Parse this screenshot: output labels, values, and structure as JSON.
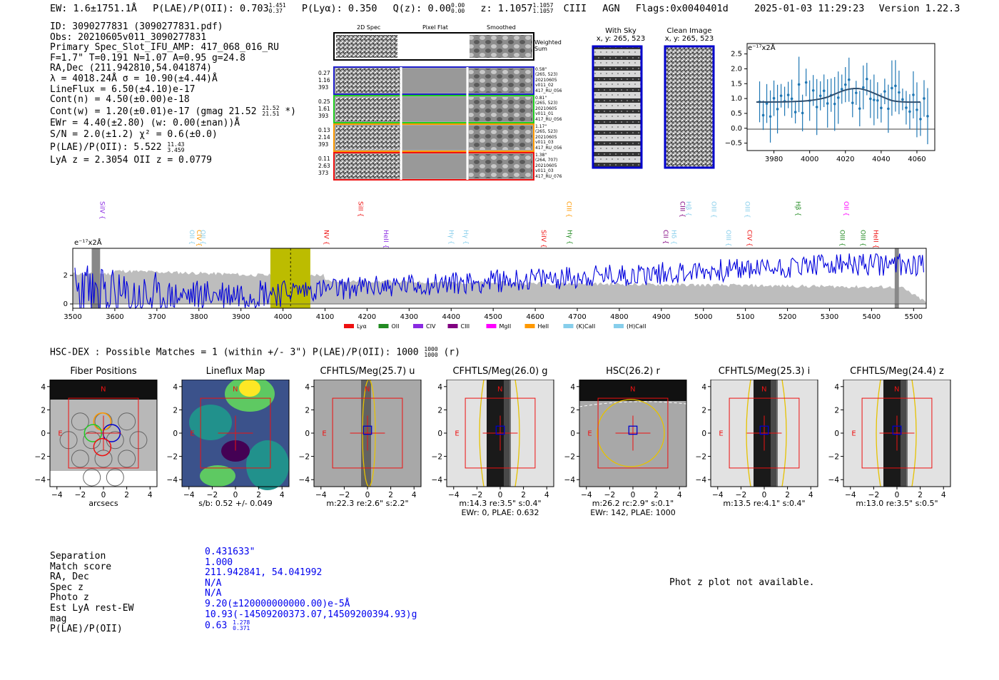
{
  "header": {
    "ew": "EW: 1.6±1751.1Å",
    "plae": "P(LAE)/P(OII): 0.703",
    "plae_hi": "1.451",
    "plae_lo": "0.37",
    "plya": "P(Lyα): 0.350",
    "qz": "Q(z): 0.00",
    "qz_hi": "0.00",
    "qz_lo": "0.00",
    "z": "z: 1.1057",
    "z_hi": "1.1057",
    "z_lo": "1.1057",
    "line": "CIII",
    "agn": "AGN",
    "flags": "Flags:0x0040401d",
    "datetime": "2025-01-03 11:29:23",
    "version": "Version 1.22.3"
  },
  "info": {
    "id": "ID: 3090277831 (3090277831.pdf)",
    "obs": "Obs: 20210605v011_3090277831",
    "primary": "Primary Spec_Slot_IFU_AMP: 417_068_016_RU",
    "fiber": "F=1.7\"  T=0.191  N=1.07  A=0.95  g=24.8",
    "radec": "RA,Dec (211.942810,54.041874)",
    "lambda": "λ = 4018.24Å   σ = 10.90(±4.44)Å",
    "lineflux": "LineFlux = 6.50(±4.10)e-17",
    "contn": "Cont(n) = 4.50(±0.00)e-18",
    "contw": "Cont(w) = 1.20(±0.01)e-17 (gmag 21.52",
    "contw_hi": "21.52",
    "contw_lo": "21.51",
    "contw_end": "*)",
    "ewr": "EWr = 4.40(±2.80) (w: 0.00(±nan))Å",
    "sn": "S/N = 2.0(±1.2)  χ² = 0.6(±0.0)",
    "plae2": "P(LAE)/P(OII): 5.522",
    "plae2_hi": "11.43",
    "plae2_lo": "3.459",
    "lyaz": "LyA z = 2.3054  OII z = 0.0779"
  },
  "cutouts": {
    "col_titles": [
      "2D Spec",
      "Pixel Flat",
      "Smoothed"
    ],
    "weighted": "Weighted\nSum",
    "rows": [
      {
        "left": [
          "0.27",
          "1.16",
          "393"
        ],
        "right": [
          "0.58\"",
          "(265, 523)",
          "20210605",
          "v011_02",
          "417_RU_056"
        ],
        "color": "#1f1fcc"
      },
      {
        "left": [
          "0.25",
          "1.61",
          "393"
        ],
        "right": [
          "0.81\"",
          "(265, 523)",
          "20210605",
          "v011_01",
          "417_RU_056"
        ],
        "color": "#22cc22"
      },
      {
        "left": [
          "0.13",
          "2.14",
          "393"
        ],
        "right": [
          "1.17\"",
          "(265, 523)",
          "20210605",
          "v011_03",
          "417_RU_056"
        ],
        "color": "#ff9900"
      },
      {
        "left": [
          "0.11",
          "2.63",
          "373"
        ],
        "right": [
          "1.38\"",
          "(264, 707)",
          "20210605",
          "v011_03",
          "417_RU_076"
        ],
        "color": "#ee1111"
      }
    ]
  },
  "sky": {
    "with_sky": "With Sky",
    "with_sky_xy": "x, y: 265, 523",
    "clean": "Clean Image",
    "clean_xy": "x, y: 265, 523"
  },
  "fit_plot": {
    "ylabel": "e⁻¹⁷x2Å",
    "xticks": [
      "3980",
      "4000",
      "4020",
      "4040",
      "4060"
    ],
    "yticks": [
      "2.5",
      "2.0",
      "1.5",
      "1.0",
      "0.5",
      "0.0",
      "−0.5"
    ]
  },
  "chart_data": {
    "type": "line",
    "ylabel": "e⁻¹⁷x2Å",
    "xlim": [
      3500,
      5530
    ],
    "xticks": [
      3500,
      3600,
      3700,
      3800,
      3900,
      4000,
      4100,
      4200,
      4300,
      4400,
      4500,
      4600,
      4700,
      4800,
      4900,
      5000,
      5100,
      5200,
      5300,
      5400,
      5500
    ],
    "yticks": [
      0,
      2
    ],
    "lines": [
      {
        "name": "SiIV",
        "color": "#8a2be2",
        "x": 3560
      },
      {
        "name": "OII",
        "color": "#87ceeb",
        "x": 3773
      },
      {
        "name": "CIV",
        "color": "#ff9900",
        "x": 3790
      },
      {
        "name": "OII",
        "color": "#87ceeb",
        "x": 3800
      },
      {
        "name": "NV",
        "color": "#ee1111",
        "x": 4093
      },
      {
        "name": "SiII",
        "color": "#ee1111",
        "x": 4175
      },
      {
        "name": "HeII",
        "color": "#8a2be2",
        "x": 4235
      },
      {
        "name": "Hγ",
        "color": "#87ceeb",
        "x": 4390
      },
      {
        "name": "Hγ",
        "color": "#87ceeb",
        "x": 4425
      },
      {
        "name": "SiIV",
        "color": "#ee1111",
        "x": 4610
      },
      {
        "name": "CIII",
        "color": "#ff9900",
        "x": 4670
      },
      {
        "name": "Hγ",
        "color": "#228b22",
        "x": 4672
      },
      {
        "name": "CII",
        "color": "#800080",
        "x": 4900
      },
      {
        "name": "Hδ",
        "color": "#87ceeb",
        "x": 4920
      },
      {
        "name": "CIII",
        "color": "#800080",
        "x": 4940
      },
      {
        "name": "Hβ",
        "color": "#87ceeb",
        "x": 4955
      },
      {
        "name": "OIII",
        "color": "#87ceeb",
        "x": 5015
      },
      {
        "name": "OIII",
        "color": "#87ceeb",
        "x": 5050
      },
      {
        "name": "OIII",
        "color": "#87ceeb",
        "x": 5095
      },
      {
        "name": "CIV",
        "color": "#ee1111",
        "x": 5100
      },
      {
        "name": "Hβ",
        "color": "#228b22",
        "x": 5215
      },
      {
        "name": "OIII",
        "color": "#228b22",
        "x": 5320
      },
      {
        "name": "OII",
        "color": "#ff00ff",
        "x": 5330
      },
      {
        "name": "OIII",
        "color": "#228b22",
        "x": 5370
      },
      {
        "name": "HeII",
        "color": "#ee1111",
        "x": 5400
      }
    ],
    "legend": [
      {
        "name": "Lyα",
        "color": "#ee1111"
      },
      {
        "name": "OII",
        "color": "#228b22"
      },
      {
        "name": "CIV",
        "color": "#8a2be2"
      },
      {
        "name": "CIII",
        "color": "#800080"
      },
      {
        "name": "MgII",
        "color": "#ff00ff"
      },
      {
        "name": "HeII",
        "color": "#ff9900"
      },
      {
        "name": "(K)CaII",
        "color": "#87ceeb"
      },
      {
        "name": "(H)CaII",
        "color": "#87ceeb"
      }
    ],
    "highlight_range": [
      3970,
      4065
    ],
    "line_marker": 4018
  },
  "hsc": {
    "title": "HSC-DEX : Possible Matches = 1 (within +/- 3\")  P(LAE)/P(OII): 1000",
    "title_hi": "1000",
    "title_lo": "1000",
    "title_end": "(r)"
  },
  "panels": [
    {
      "title": "Fiber Positions",
      "cap1": "arcsecs",
      "cap2": ""
    },
    {
      "title": "Lineflux Map",
      "cap1": "s/b: 0.52 +/- 0.049",
      "cap2": ""
    },
    {
      "title": "CFHTLS/Meg(25.7) u",
      "cap1": "m:22.3   re:2.6\"   s:2.2\"",
      "cap2": ""
    },
    {
      "title": "CFHTLS/Meg(26.0) g",
      "cap1": "m:14.3   re:3.5\"   s:0.4\"",
      "cap2": "EWr: 0, PLAE: 0.632"
    },
    {
      "title": "HSC(26.2) r",
      "cap1": "m:26.2 rc:2.9\"  s:0.1\"",
      "cap2": "EWr: 142, PLAE: 1000"
    },
    {
      "title": "CFHTLS/Meg(25.3) i",
      "cap1": "m:13.5   re:4.1\"   s:0.4\"",
      "cap2": ""
    },
    {
      "title": "CFHTLS/Meg(24.4) z",
      "cap1": "m:13.0   re:3.5\"   s:0.5\"",
      "cap2": ""
    }
  ],
  "panel_ticks": {
    "x": [
      "−4",
      "−2",
      "0",
      "2",
      "4"
    ],
    "y": [
      "4",
      "2",
      "0",
      "−2",
      "−4"
    ],
    "n": "N",
    "e": "E"
  },
  "match": {
    "labels": [
      "Separation",
      "Match score",
      "RA, Dec",
      "Spec z",
      "Photo z",
      "Est LyA rest-EW",
      "mag",
      "P(LAE)/P(OII)"
    ],
    "values": [
      "0.431633\"",
      "1.000",
      "211.942841, 54.041992",
      "N/A",
      "N/A",
      "9.20(±120000000000.00)e-5Å",
      "10.93(-14509200373.07,14509200394.93)g",
      "0.63"
    ],
    "plae_hi": "1.278",
    "plae_lo": "0.371",
    "photz_note": "Phot z plot not available."
  }
}
